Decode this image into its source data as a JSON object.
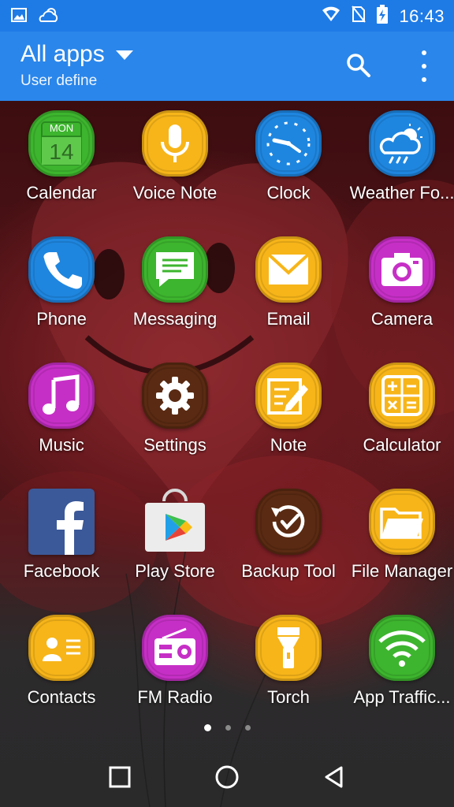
{
  "status_bar": {
    "time": "16:43",
    "icons": [
      "image-icon",
      "weather-cloud-icon",
      "wifi-icon",
      "no-sim-icon",
      "battery-charging-icon"
    ]
  },
  "header": {
    "title": "All apps",
    "subtitle": "User define",
    "search_icon": "search-icon",
    "menu_icon": "overflow-menu-icon",
    "color": "#2a86ea"
  },
  "apps": [
    {
      "label": "Calendar",
      "icon": "calendar-icon",
      "color": "#3db52e",
      "calendar_day": "MON",
      "calendar_date": "14"
    },
    {
      "label": "Voice Note",
      "icon": "microphone-icon",
      "color": "#f7b519"
    },
    {
      "label": "Clock",
      "icon": "clock-icon",
      "color": "#1f86df"
    },
    {
      "label": "Weather Fo...",
      "icon": "weather-icon",
      "color": "#1f86df"
    },
    {
      "label": "Phone",
      "icon": "phone-icon",
      "color": "#1f86df"
    },
    {
      "label": "Messaging",
      "icon": "message-icon",
      "color": "#3db52e"
    },
    {
      "label": "Email",
      "icon": "envelope-icon",
      "color": "#f7b519"
    },
    {
      "label": "Camera",
      "icon": "camera-icon",
      "color": "#c62fc6"
    },
    {
      "label": "Music",
      "icon": "music-note-icon",
      "color": "#c62fc6"
    },
    {
      "label": "Settings",
      "icon": "gear-icon",
      "color": "#5a2a12"
    },
    {
      "label": "Note",
      "icon": "note-edit-icon",
      "color": "#f7b519"
    },
    {
      "label": "Calculator",
      "icon": "calculator-icon",
      "color": "#f7b519"
    },
    {
      "label": "Facebook",
      "icon": "facebook-icon",
      "color": "#3b5998"
    },
    {
      "label": "Play Store",
      "icon": "play-store-icon",
      "color": "#e8e8e8"
    },
    {
      "label": "Backup Tool",
      "icon": "backup-icon",
      "color": "#5a2a12"
    },
    {
      "label": "File Manager",
      "icon": "folder-icon",
      "color": "#f7b519"
    },
    {
      "label": "Contacts",
      "icon": "contact-card-icon",
      "color": "#f7b519"
    },
    {
      "label": "FM Radio",
      "icon": "radio-icon",
      "color": "#c62fc6"
    },
    {
      "label": "Torch",
      "icon": "flashlight-icon",
      "color": "#f7b519"
    },
    {
      "label": "App Traffic...",
      "icon": "wifi-traffic-icon",
      "color": "#3db52e"
    }
  ],
  "pager": {
    "pages": 3,
    "current": 1
  },
  "nav": {
    "back_icon": "back-triangle-icon",
    "home_icon": "home-circle-icon",
    "recents_icon": "recents-square-icon"
  }
}
